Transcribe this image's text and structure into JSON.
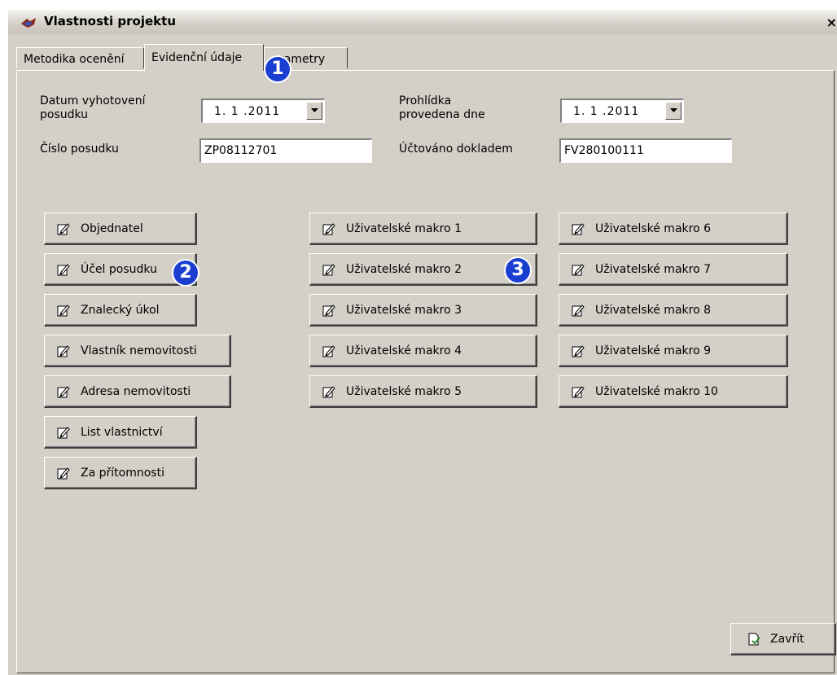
{
  "window": {
    "title": "Vlastnosti projektu",
    "close_glyph": "×"
  },
  "tabs": [
    {
      "label": "Metodika ocenění",
      "active": false
    },
    {
      "label": "Evidenční údaje",
      "active": true
    },
    {
      "label": "rametry",
      "active": false
    }
  ],
  "form": {
    "date_made_label": "Datum vyhotovení posudku",
    "date_made_value": "1. 1 .2011",
    "inspection_label": "Prohlídka provedena dne",
    "inspection_value": "1. 1 .2011",
    "report_number_label": "Číslo posudku",
    "report_number_value": "ZP08112701",
    "invoice_label": "Účtováno dokladem",
    "invoice_value": "FV280100111"
  },
  "buttons_left": [
    "Objednatel",
    "Účel posudku",
    "Znalecký úkol",
    "Vlastník nemovitosti",
    "Adresa nemovitosti",
    "List vlastnictví",
    "Za přítomnosti"
  ],
  "buttons_mid": [
    "Uživatelské makro 1",
    "Uživatelské makro 2",
    "Uživatelské makro 3",
    "Uživatelské makro 4",
    "Uživatelské makro 5"
  ],
  "buttons_right": [
    "Uživatelské makro 6",
    "Uživatelské makro 7",
    "Uživatelské makro 8",
    "Uživatelské makro 9",
    "Uživatelské makro 10"
  ],
  "close_button": "Zavřít",
  "badges": [
    "1",
    "2",
    "3"
  ],
  "icons": {
    "edit": "edit-icon",
    "close": "close-doc-icon",
    "app": "app-icon"
  },
  "colors": {
    "badge": "#1a3fd0",
    "face": "#d4d0c8"
  }
}
